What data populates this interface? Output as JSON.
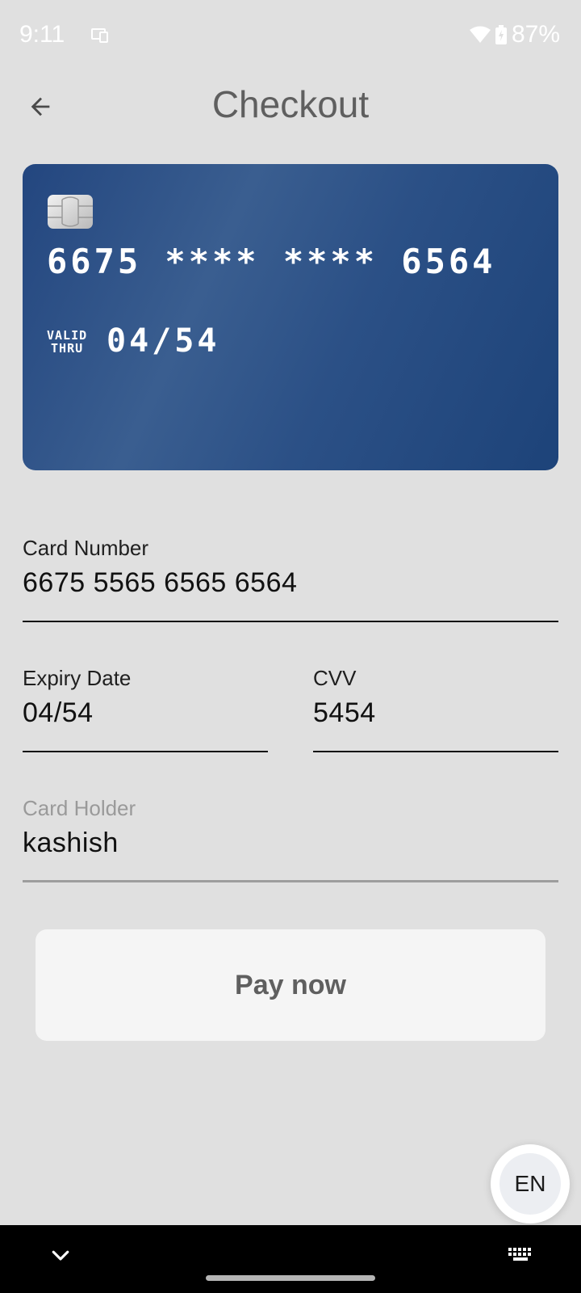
{
  "status_bar": {
    "time": "9:11",
    "battery": "87%"
  },
  "app_bar": {
    "title": "Checkout",
    "back_icon": "arrow-back-icon"
  },
  "card_preview": {
    "number_masked": "6675 **** **** 6564",
    "valid_thru_line1": "VALID",
    "valid_thru_line2": "THRU",
    "expiry": "04/54",
    "background_color": "#2b5086"
  },
  "form": {
    "card_number": {
      "label": "Card Number",
      "value": "6675 5565 6565 6564"
    },
    "expiry_date": {
      "label": "Expiry Date",
      "value": "04/54"
    },
    "cvv": {
      "label": "CVV",
      "value": "5454"
    },
    "card_holder": {
      "label": "Card Holder",
      "value": "kashish"
    }
  },
  "pay_button": {
    "label": "Pay now"
  },
  "keyboard_language": {
    "label": "EN"
  },
  "colors": {
    "background": "#e0e0e0",
    "button_bg": "#f5f5f5",
    "title_text": "#5f5f5f"
  }
}
